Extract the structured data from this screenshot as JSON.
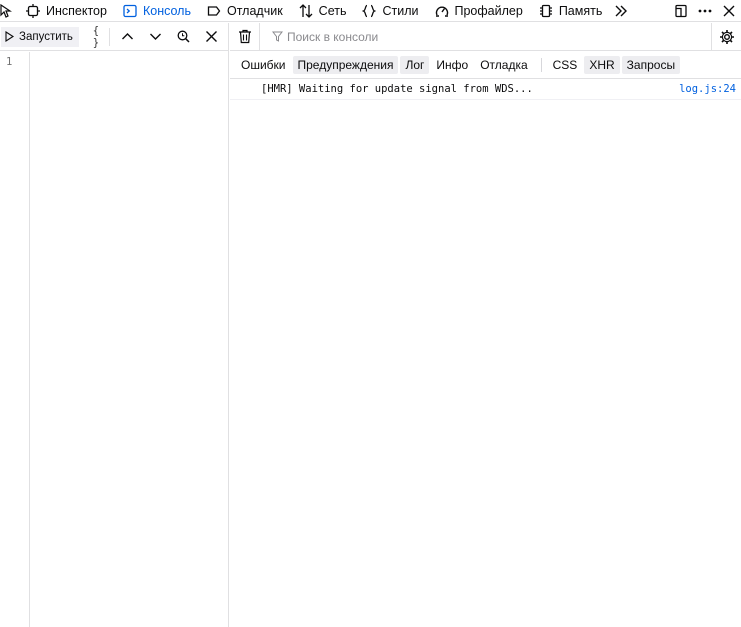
{
  "toolbar": {
    "tabs": [
      {
        "label": "Инспектор",
        "icon": "inspector-icon"
      },
      {
        "label": "Консоль",
        "icon": "console-icon",
        "active": true
      },
      {
        "label": "Отладчик",
        "icon": "debugger-icon"
      },
      {
        "label": "Сеть",
        "icon": "network-icon"
      },
      {
        "label": "Стили",
        "icon": "style-editor-icon"
      },
      {
        "label": "Профайлер",
        "icon": "profiler-icon"
      },
      {
        "label": "Память",
        "icon": "memory-icon"
      }
    ],
    "active_color": "#0060df"
  },
  "editor": {
    "run_label": "Запустить",
    "pretty_label": "{ }",
    "line_numbers": [
      "1"
    ]
  },
  "console": {
    "search_placeholder": "Поиск в консоли",
    "levels": [
      {
        "label": "Ошибки",
        "on": false
      },
      {
        "label": "Предупреждения",
        "on": true
      },
      {
        "label": "Лог",
        "on": true
      },
      {
        "label": "Инфо",
        "on": false
      },
      {
        "label": "Отладка",
        "on": false
      }
    ],
    "types": [
      {
        "label": "CSS",
        "on": false
      },
      {
        "label": "XHR",
        "on": true
      },
      {
        "label": "Запросы",
        "on": true
      }
    ],
    "messages": [
      {
        "text": "[HMR] Waiting for update signal from WDS...",
        "source": "log.js:24"
      }
    ]
  }
}
